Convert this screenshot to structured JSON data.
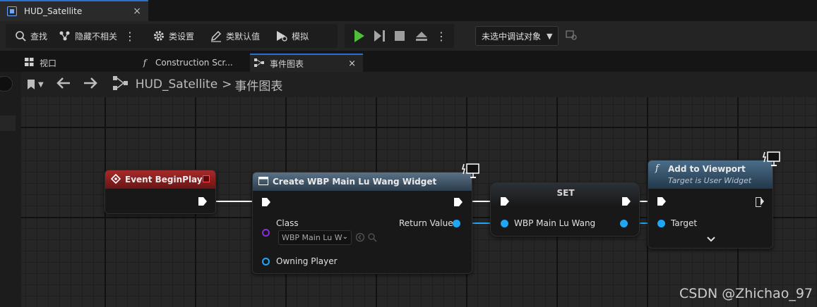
{
  "window": {
    "tab_title": "HUD_Satellite",
    "close": "×"
  },
  "toolbar": {
    "find": "查找",
    "hide_unrelated": "隐藏不相关",
    "class_settings": "类设置",
    "class_defaults": "类默认值",
    "simulate": "模拟",
    "debug_target": "未选中调试对象",
    "more": "⋮"
  },
  "panel_tabs": [
    {
      "label": "视口",
      "icon": "viewport-icon"
    },
    {
      "label": "Construction Scr...",
      "icon": "function-icon"
    },
    {
      "label": "事件图表",
      "icon": "graph-icon",
      "close": "×"
    }
  ],
  "graph_header": {
    "blueprint": "HUD_Satellite",
    "separator": ">",
    "graph": "事件图表"
  },
  "nodes": {
    "begin_play": {
      "title": "Event BeginPlay",
      "color": "#8a1e1e"
    },
    "create_widget": {
      "title": "Create WBP Main Lu Wang Widget",
      "class_label": "Class",
      "class_value": "WBP Main Lu W",
      "return_label": "Return Value",
      "owning_player": "Owning Player",
      "color": "#3d5468"
    },
    "set": {
      "title": "SET",
      "var_label": "WBP Main Lu Wang"
    },
    "add_viewport": {
      "title": "Add to Viewport",
      "subtitle": "Target is User Widget",
      "target_label": "Target",
      "color": "#2e4f6a"
    }
  },
  "colors": {
    "exec": "#ffffff",
    "object_pin": "#21a6f4",
    "class_pin": "#8a2be2",
    "accent": "#2b6fcf",
    "play": "#4fbf3a"
  },
  "watermark": "CSDN @Zhichao_97"
}
